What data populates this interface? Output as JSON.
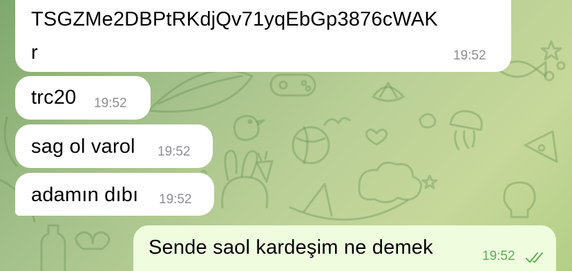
{
  "messages": [
    {
      "id": "wallet-address",
      "direction": "incoming",
      "lines": [
        "TSGZMe2DBPtRKdjQv71yqEbGp3876cWAK",
        "r"
      ],
      "time": "19:52"
    },
    {
      "id": "network",
      "direction": "incoming",
      "text": "trc20",
      "time": "19:52"
    },
    {
      "id": "thanks",
      "direction": "incoming",
      "text": "sag ol varol",
      "time": "19:52"
    },
    {
      "id": "compliment",
      "direction": "incoming",
      "text": "adamın dıbı",
      "time": "19:52"
    },
    {
      "id": "reply",
      "direction": "outgoing",
      "text": "Sende saol kardeşim ne demek",
      "time": "19:52",
      "status_icon": "double-check-icon"
    }
  ],
  "colors": {
    "incoming_bubble": "#ffffff",
    "outgoing_bubble": "#effdde",
    "timestamp": "#8e8e93",
    "outgoing_timestamp": "#5fae53",
    "read_ticks": "#5fae53"
  }
}
